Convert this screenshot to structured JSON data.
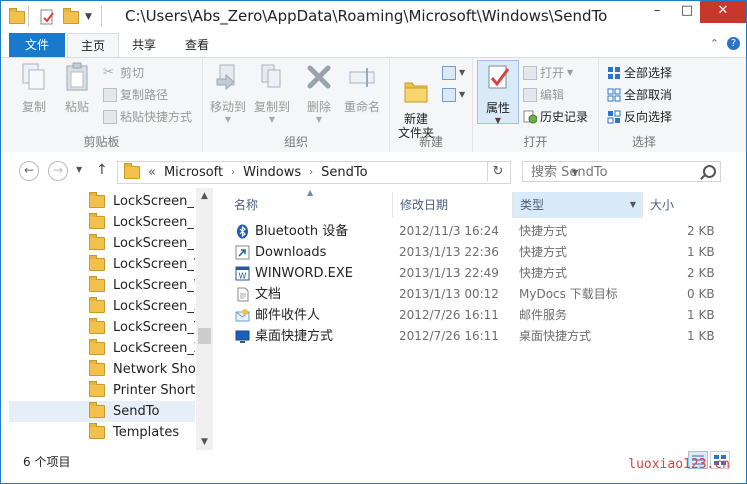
{
  "window": {
    "title": "C:\\Users\\Abs_Zero\\AppData\\Roaming\\Microsoft\\Windows\\SendTo",
    "minimize": "–",
    "maximize": "□",
    "close": "✕"
  },
  "ribbon_tabs": {
    "file": "文件",
    "home": "主页",
    "share": "共享",
    "view": "查看"
  },
  "ribbon": {
    "clipboard": {
      "label": "剪贴板",
      "copy": "复制",
      "paste": "粘贴",
      "cut": "剪切",
      "copy_path": "复制路径",
      "paste_shortcut": "粘贴快捷方式"
    },
    "organize": {
      "label": "组织",
      "move_to": "移动到",
      "copy_to": "复制到",
      "delete": "删除",
      "rename": "重命名"
    },
    "new": {
      "label": "新建",
      "new_folder": "新建\n文件夹"
    },
    "open": {
      "label": "打开",
      "properties": "属性",
      "open": "打开",
      "edit": "编辑",
      "history": "历史记录"
    },
    "select": {
      "label": "选择",
      "select_all": "全部选择",
      "select_none": "全部取消",
      "invert": "反向选择"
    }
  },
  "nav": {
    "back": "←",
    "forward": "→",
    "up": "↑",
    "breadcrumb_sep": "«",
    "crumbs": [
      "Microsoft",
      "Windows",
      "SendTo"
    ],
    "refresh": "↻",
    "search_placeholder": "搜索 SendTo"
  },
  "nav_pane": {
    "items": [
      "LockScreen_B",
      "LockScreen_E",
      "LockScreen_U",
      "LockScreen_V",
      "LockScreen_W",
      "LockScreen_X",
      "LockScreen_Y",
      "LockScreen_Z",
      "Network Shortc",
      "Printer Shortcu",
      "SendTo",
      "Templates"
    ],
    "selected_index": 10
  },
  "columns": {
    "name": "名称",
    "modified": "修改日期",
    "type": "类型",
    "size": "大小"
  },
  "files": [
    {
      "name": "Bluetooth 设备",
      "modified": "2012/11/3 16:24",
      "type": "快捷方式",
      "size": "2 KB",
      "icon": "bluetooth-icon"
    },
    {
      "name": "Downloads",
      "modified": "2013/1/13 22:36",
      "type": "快捷方式",
      "size": "1 KB",
      "icon": "shortcut-icon"
    },
    {
      "name": "WINWORD.EXE",
      "modified": "2013/1/13 22:49",
      "type": "快捷方式",
      "size": "2 KB",
      "icon": "word-icon"
    },
    {
      "name": "文档",
      "modified": "2013/1/13 00:12",
      "type": "MyDocs 下载目标",
      "size": "0 KB",
      "icon": "document-icon"
    },
    {
      "name": "邮件收件人",
      "modified": "2012/7/26 16:11",
      "type": "邮件服务",
      "size": "1 KB",
      "icon": "mail-icon"
    },
    {
      "name": "桌面快捷方式",
      "modified": "2012/7/26 16:11",
      "type": "桌面快捷方式",
      "size": "1 KB",
      "icon": "desktop-icon"
    }
  ],
  "status": {
    "item_count": "6 个项目",
    "watermark": "luoxiao123.cn"
  },
  "colors": {
    "accent": "#1979ca",
    "close": "#c7372c",
    "selection": "#e6eef7",
    "sorted_col": "#d9ebf9"
  }
}
